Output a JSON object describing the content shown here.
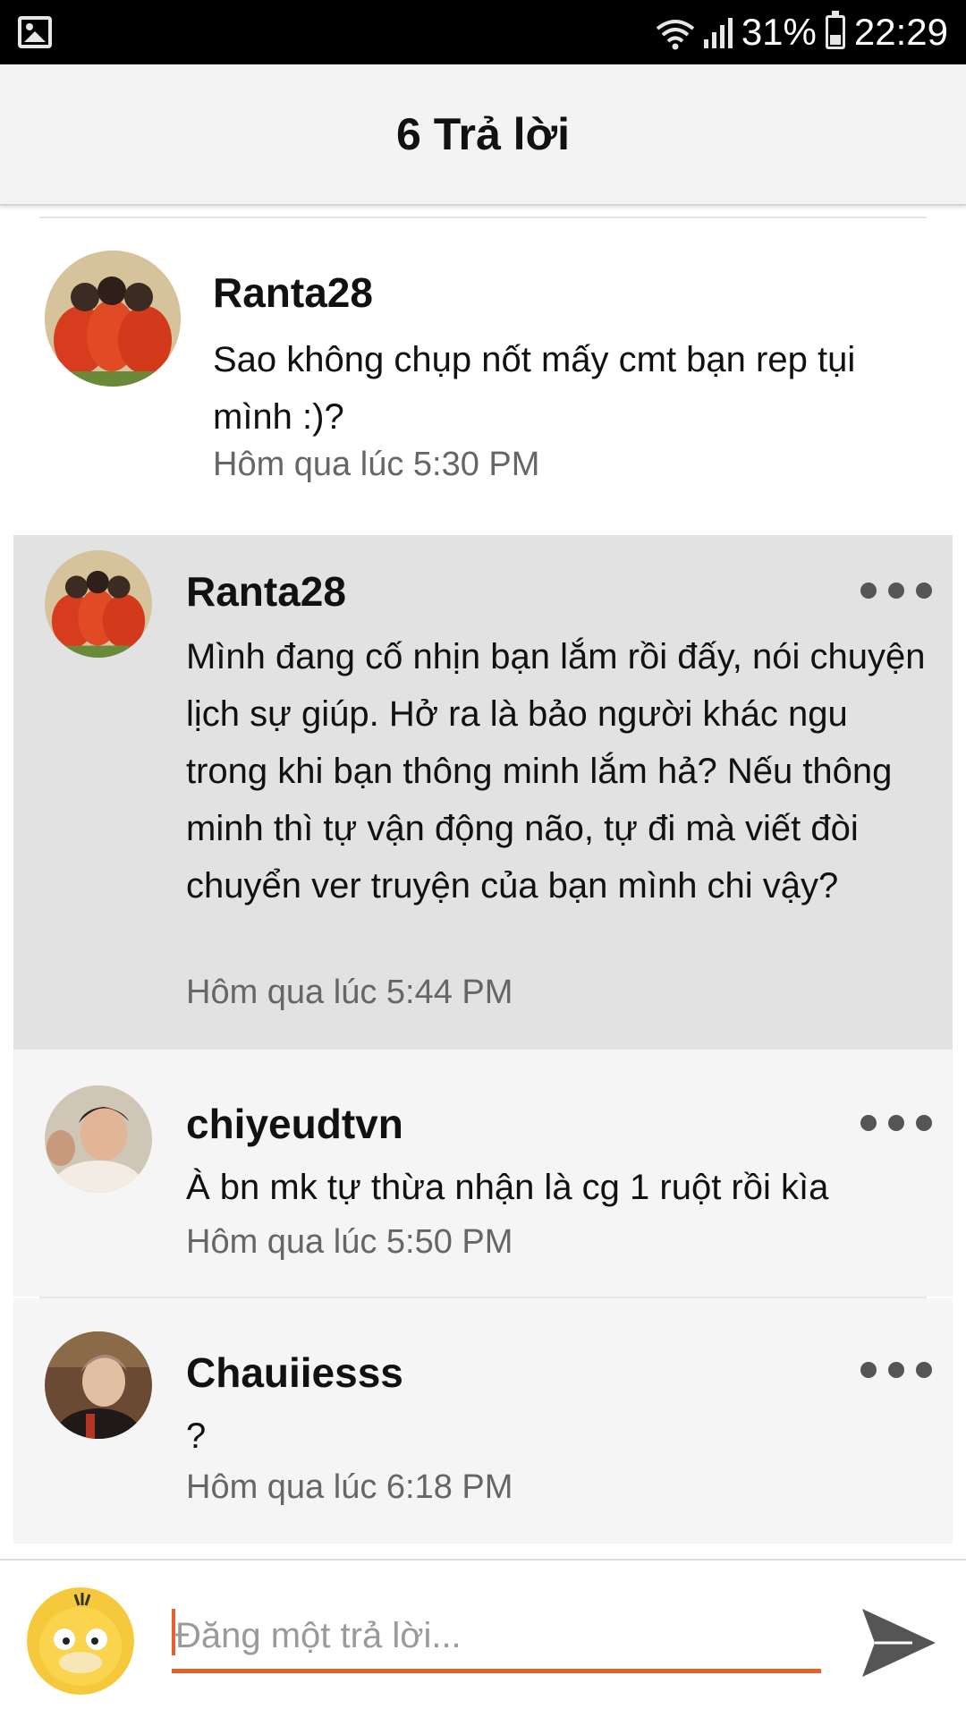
{
  "status_bar": {
    "battery": "31%",
    "time": "22:29",
    "icons": [
      "gallery-icon",
      "wifi-icon",
      "signal-icon",
      "battery-icon"
    ]
  },
  "header": {
    "title": "6 Trả lời"
  },
  "comments": [
    {
      "username": "Ranta28",
      "text": "Sao không chụp nốt mấy cmt bạn rep tụi mình :)?",
      "time": "Hôm qua lúc 5:30 PM",
      "avatar": "team-photo-avatar"
    },
    {
      "username": "Ranta28",
      "text": "Mình đang cố nhịn bạn lắm rồi đấy, nói chuyện lịch sự giúp. Hở ra là bảo người khác ngu trong khi bạn thông minh lắm hả? Nếu thông minh thì tự vận động não, tự đi mà viết đòi chuyển ver truyện của bạn mình chi vậy?",
      "time": "Hôm qua lúc 5:44 PM",
      "avatar": "team-photo-avatar",
      "highlighted": true
    },
    {
      "username": "chiyeudtvn",
      "text": "À bn mk tự thừa nhận là cg 1 ruột rồi kìa",
      "time": "Hôm qua lúc 5:50 PM",
      "avatar": "person-avatar"
    },
    {
      "username": "Chauiiesss",
      "text": "?",
      "time": "Hôm qua lúc 6:18 PM",
      "avatar": "person-avatar"
    }
  ],
  "reply_bar": {
    "placeholder": "Đăng một trả lời...",
    "send_icon": "send-icon"
  },
  "colors": {
    "accent": "#e8602c",
    "highlight_bg": "#e2e2e2",
    "panel_bg": "#f5f5f5",
    "header_bg": "#f3f3f3"
  }
}
